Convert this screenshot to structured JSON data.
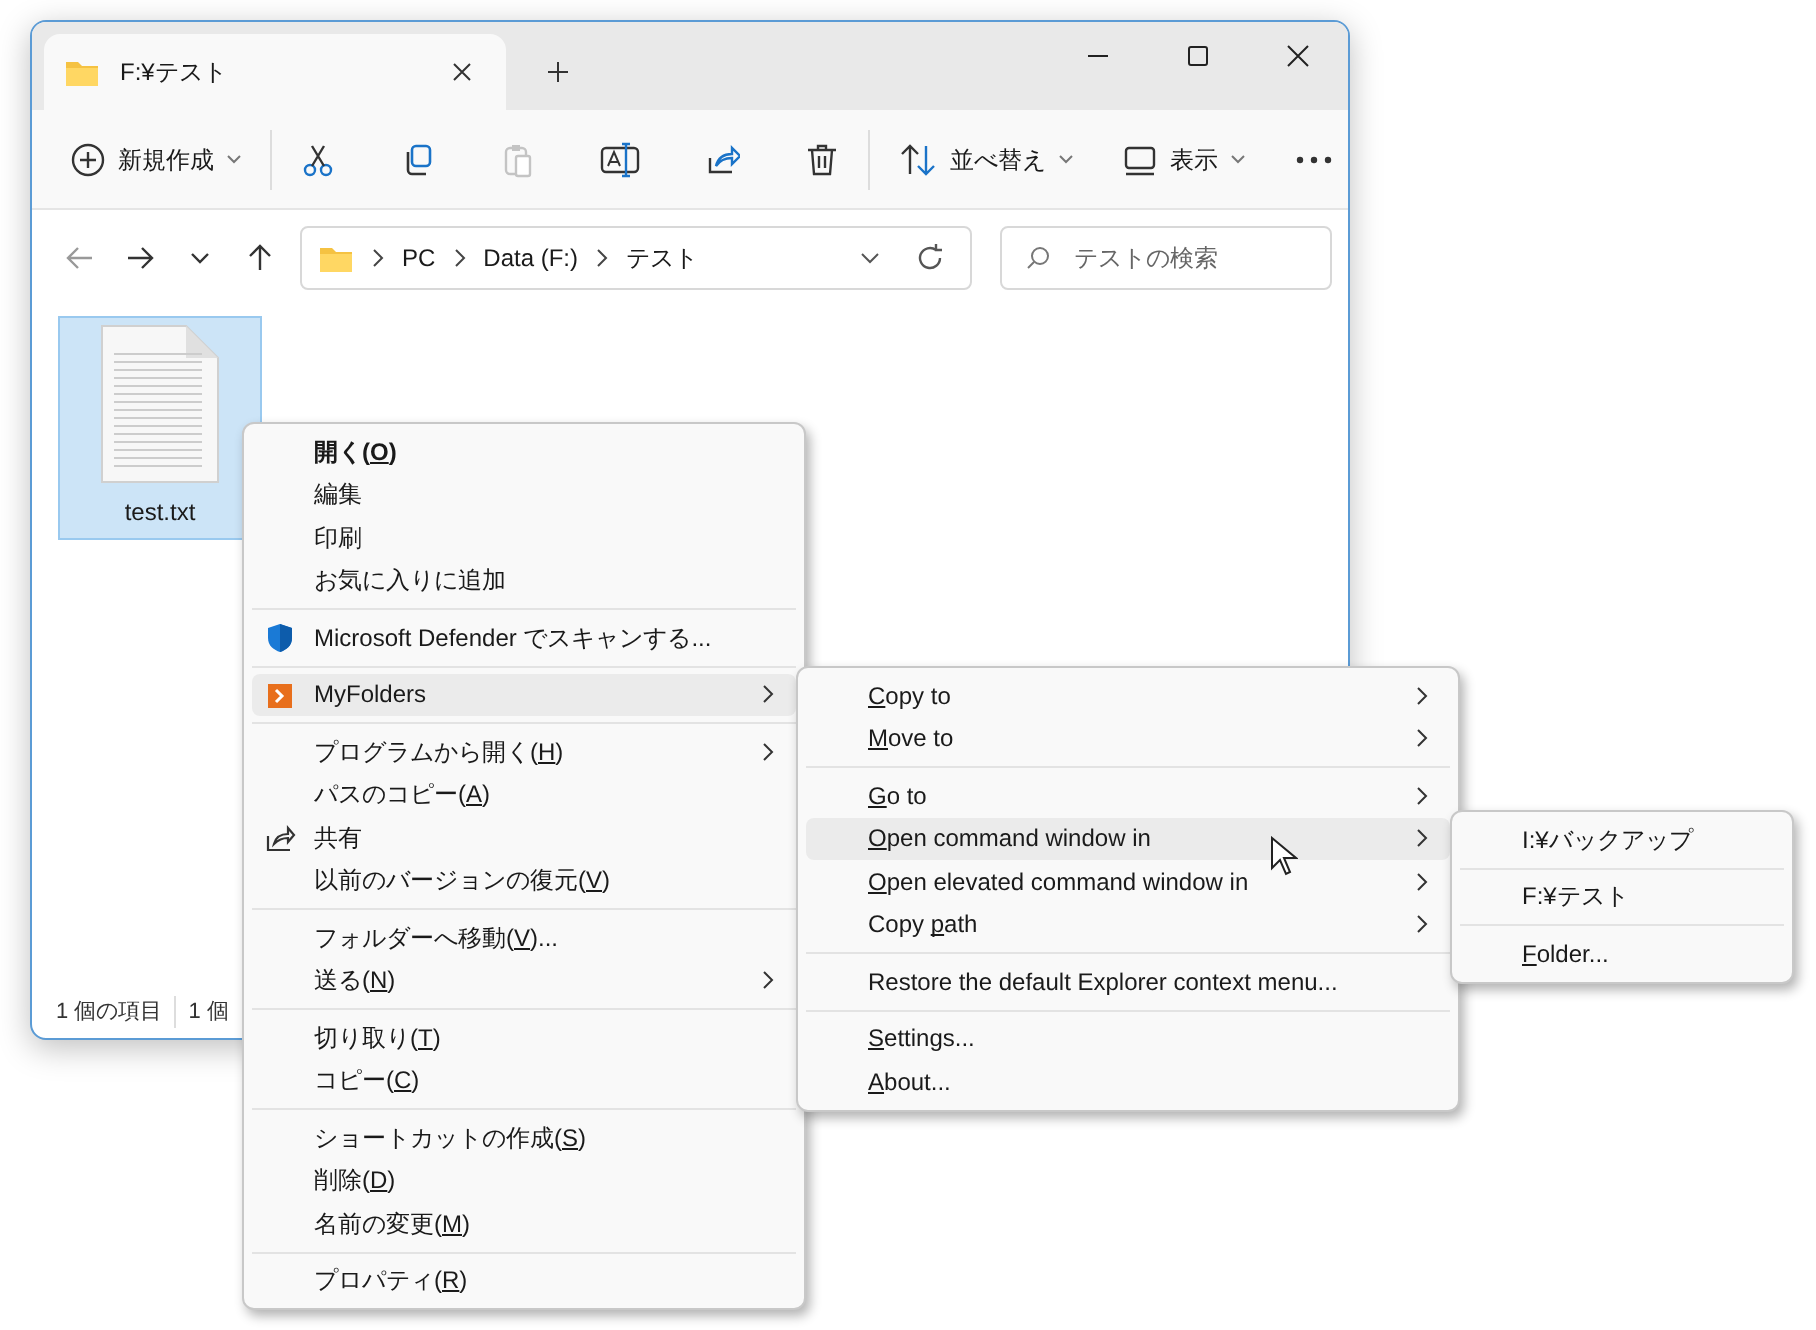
{
  "window": {
    "tab": {
      "title": "F:¥テスト",
      "selected": true
    }
  },
  "toolbar": {
    "groups": [
      [
        {
          "label": "新規作成",
          "dropdown": true,
          "disabled": false
        }
      ],
      [
        {
          "dropdown": false,
          "disabled": false
        },
        {
          "dropdown": false,
          "disabled": false
        },
        {
          "dropdown": false,
          "disabled": true
        },
        {
          "dropdown": false,
          "disabled": false
        },
        {
          "dropdown": false,
          "disabled": false
        },
        {
          "dropdown": false,
          "disabled": false
        }
      ],
      [
        {
          "label": "並べ替え",
          "dropdown": true,
          "disabled": false
        },
        {
          "label": "表示",
          "dropdown": true,
          "disabled": false
        },
        {
          "dropdown": false,
          "disabled": false
        }
      ]
    ]
  },
  "nav": [
    {
      "disabled": true
    },
    {
      "disabled": false
    },
    {
      "disabled": false
    },
    {
      "disabled": false
    }
  ],
  "address": {
    "crumbs": [
      "PC",
      "Data (F:)",
      "テスト"
    ]
  },
  "search": {
    "placeholder": "テストの検索"
  },
  "files": [
    {
      "name": "test.txt",
      "selected": true
    }
  ],
  "status_bar": [
    "1 個の項目",
    "1 個"
  ],
  "context_menu": {
    "groups": [
      [
        {
          "label": [
            {
              "text": "開く(",
              "access_key": false
            },
            {
              "text": "O",
              "access_key": true
            },
            {
              "text": ")",
              "access_key": false
            }
          ],
          "bold": true,
          "submenu": false,
          "selected": false
        },
        {
          "label": "編集",
          "bold": false,
          "submenu": false,
          "selected": false
        },
        {
          "label": "印刷",
          "bold": false,
          "submenu": false,
          "selected": false
        },
        {
          "label": "お気に入りに追加",
          "bold": false,
          "submenu": false,
          "selected": false
        }
      ],
      [
        {
          "label": "Microsoft Defender でスキャンする...",
          "kind": "defender",
          "bold": false,
          "submenu": false,
          "selected": false
        }
      ],
      [
        {
          "label": "MyFolders",
          "kind": "myfolders",
          "bold": false,
          "submenu": true,
          "selected": true
        }
      ],
      [
        {
          "label": [
            {
              "text": "プログラムから開く(",
              "access_key": false
            },
            {
              "text": "H",
              "access_key": true
            },
            {
              "text": ")",
              "access_key": false
            }
          ],
          "bold": false,
          "submenu": true,
          "selected": false
        },
        {
          "label": [
            {
              "text": "パスのコピー(",
              "access_key": false
            },
            {
              "text": "A",
              "access_key": true
            },
            {
              "text": ")",
              "access_key": false
            }
          ],
          "bold": false,
          "submenu": false,
          "selected": false
        },
        {
          "label": "共有",
          "kind": "share",
          "bold": false,
          "submenu": false,
          "selected": false
        },
        {
          "label": [
            {
              "text": "以前のバージョンの復元(",
              "access_key": false
            },
            {
              "text": "V",
              "access_key": true
            },
            {
              "text": ")",
              "access_key": false
            }
          ],
          "bold": false,
          "submenu": false,
          "selected": false
        }
      ],
      [
        {
          "label": [
            {
              "text": "フォルダーへ移動(",
              "access_key": false
            },
            {
              "text": "V",
              "access_key": true
            },
            {
              "text": ")...",
              "access_key": false
            }
          ],
          "bold": false,
          "submenu": false,
          "selected": false
        },
        {
          "label": [
            {
              "text": "送る(",
              "access_key": false
            },
            {
              "text": "N",
              "access_key": true
            },
            {
              "text": ")",
              "access_key": false
            }
          ],
          "bold": false,
          "submenu": true,
          "selected": false
        }
      ],
      [
        {
          "label": [
            {
              "text": "切り取り(",
              "access_key": false
            },
            {
              "text": "T",
              "access_key": true
            },
            {
              "text": ")",
              "access_key": false
            }
          ],
          "bold": false,
          "submenu": false,
          "selected": false
        },
        {
          "label": [
            {
              "text": "コピー(",
              "access_key": false
            },
            {
              "text": "C",
              "access_key": true
            },
            {
              "text": ")",
              "access_key": false
            }
          ],
          "bold": false,
          "submenu": false,
          "selected": false
        }
      ],
      [
        {
          "label": [
            {
              "text": "ショートカットの作成(",
              "access_key": false
            },
            {
              "text": "S",
              "access_key": true
            },
            {
              "text": ")",
              "access_key": false
            }
          ],
          "bold": false,
          "submenu": false,
          "selected": false
        },
        {
          "label": [
            {
              "text": "削除(",
              "access_key": false
            },
            {
              "text": "D",
              "access_key": true
            },
            {
              "text": ")",
              "access_key": false
            }
          ],
          "bold": false,
          "submenu": false,
          "selected": false
        },
        {
          "label": [
            {
              "text": "名前の変更(",
              "access_key": false
            },
            {
              "text": "M",
              "access_key": true
            },
            {
              "text": ")",
              "access_key": false
            }
          ],
          "bold": false,
          "submenu": false,
          "selected": false
        }
      ],
      [
        {
          "label": [
            {
              "text": "プロパティ(",
              "access_key": false
            },
            {
              "text": "R",
              "access_key": true
            },
            {
              "text": ")",
              "access_key": false
            }
          ],
          "bold": false,
          "submenu": false,
          "selected": false
        }
      ]
    ]
  },
  "myfolders_menu": {
    "groups": [
      [
        {
          "label": [
            {
              "text": "C",
              "access_key": true
            },
            {
              "text": "opy to",
              "access_key": false
            }
          ],
          "submenu": true,
          "selected": false
        },
        {
          "label": [
            {
              "text": "M",
              "access_key": true
            },
            {
              "text": "ove to",
              "access_key": false
            }
          ],
          "submenu": true,
          "selected": false
        }
      ],
      [
        {
          "label": [
            {
              "text": "G",
              "access_key": true
            },
            {
              "text": "o to",
              "access_key": false
            }
          ],
          "submenu": true,
          "selected": false
        },
        {
          "label": [
            {
              "text": "O",
              "access_key": true
            },
            {
              "text": "pen command window in",
              "access_key": false
            }
          ],
          "submenu": true,
          "selected": true
        },
        {
          "label": [
            {
              "text": "O",
              "access_key": true
            },
            {
              "text": "pen elevated command window in",
              "access_key": false
            }
          ],
          "submenu": true,
          "selected": false
        },
        {
          "label": [
            {
              "text": "Copy ",
              "access_key": false
            },
            {
              "text": "p",
              "access_key": true
            },
            {
              "text": "ath",
              "access_key": false
            }
          ],
          "submenu": true,
          "selected": false
        }
      ],
      [
        {
          "label": "Restore the default Explorer context menu...",
          "submenu": false,
          "selected": false
        }
      ],
      [
        {
          "label": [
            {
              "text": "S",
              "access_key": true
            },
            {
              "text": "ettings...",
              "access_key": false
            }
          ],
          "submenu": false,
          "selected": false
        },
        {
          "label": [
            {
              "text": "A",
              "access_key": true
            },
            {
              "text": "bout...",
              "access_key": false
            }
          ],
          "submenu": false,
          "selected": false
        }
      ]
    ]
  },
  "command_window_menu": {
    "groups": [
      [
        {
          "label": "I:¥バックアップ"
        }
      ],
      [
        {
          "label": "F:¥テスト"
        }
      ],
      [
        {
          "label": [
            {
              "text": "F",
              "access_key": true
            },
            {
              "text": "older...",
              "access_key": false
            }
          ]
        }
      ]
    ]
  }
}
